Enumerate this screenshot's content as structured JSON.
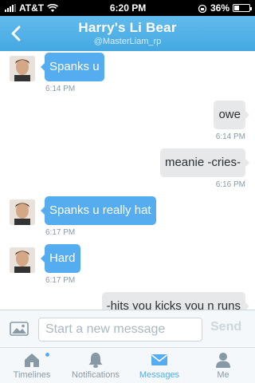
{
  "status_bar": {
    "carrier": "AT&T",
    "time": "6:20 PM",
    "battery": "36%",
    "battery_fraction": 0.36
  },
  "header": {
    "title": "Harry's Li Bear",
    "subtitle": "@MasterLiam_rp",
    "back_icon": "chevron-left-icon"
  },
  "messages": [
    {
      "direction": "in",
      "text": "Spanks u",
      "time": "6:14 PM"
    },
    {
      "direction": "out",
      "text": "owe",
      "time": "6:14 PM"
    },
    {
      "direction": "out",
      "text": "meanie -cries-",
      "time": "6:16 PM"
    },
    {
      "direction": "in",
      "text": "Spanks u really hat",
      "time": "6:17 PM"
    },
    {
      "direction": "in",
      "text": "Hard",
      "time": "6:17 PM"
    },
    {
      "direction": "out",
      "text": "-hits you kicks you n runs"
    }
  ],
  "compose": {
    "placeholder": "Start a new message",
    "send_label": "Send",
    "photo_icon": "photo-icon"
  },
  "tabs": [
    {
      "label": "Timelines",
      "icon": "home-icon",
      "active": false,
      "badge": true
    },
    {
      "label": "Notifications",
      "icon": "bell-icon",
      "active": false
    },
    {
      "label": "Messages",
      "icon": "envelope-icon",
      "active": true
    },
    {
      "label": "Me",
      "icon": "person-icon",
      "active": false
    }
  ],
  "colors": {
    "accent": "#55acee",
    "outgoing_bubble": "#e6e8ea",
    "nav_bar": "#55acee"
  }
}
